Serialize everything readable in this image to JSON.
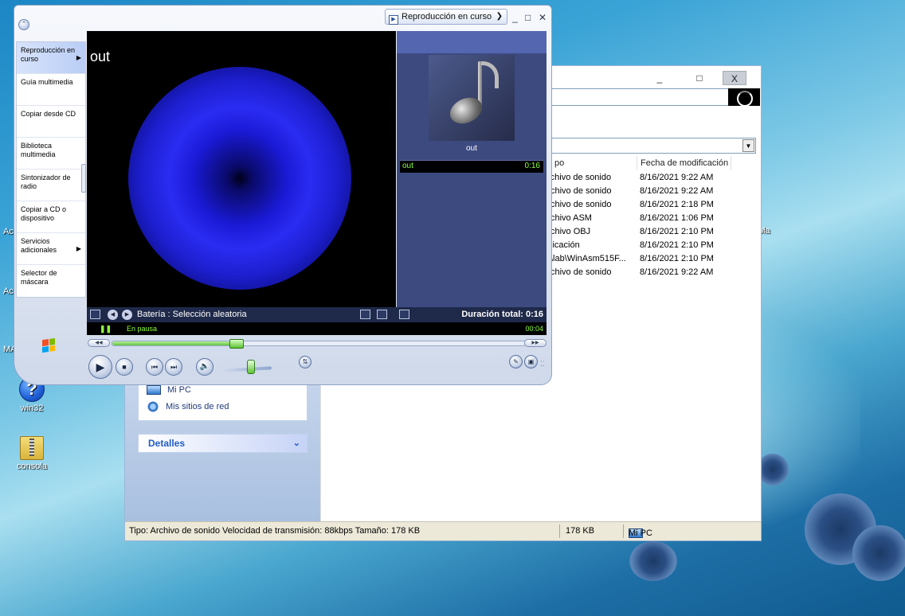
{
  "desktop": {
    "icons": [
      {
        "label": "win32",
        "icon": "help-icon"
      },
      {
        "label": "consola",
        "icon": "zip-folder-icon"
      }
    ],
    "edge_labels": [
      "Ac",
      "Ac",
      "MA",
      "ola"
    ]
  },
  "explorer": {
    "title_buttons": {
      "minimize": "_",
      "maximize": "□",
      "close": "X"
    },
    "columns": {
      "type": "po",
      "modified": "Fecha de modificación"
    },
    "files": [
      {
        "type": "rchivo de sonido",
        "modified": "8/16/2021 9:22 AM"
      },
      {
        "type": "chivo de sonido",
        "modified": "8/16/2021 9:22 AM"
      },
      {
        "type": "chivo de sonido",
        "modified": "8/16/2021 2:18 PM"
      },
      {
        "type": "chivo ASM",
        "modified": "8/16/2021 1:06 PM"
      },
      {
        "type": "chivo OBJ",
        "modified": "8/16/2021 2:10 PM"
      },
      {
        "type": "licación",
        "modified": "8/16/2021 2:10 PM"
      },
      {
        "type": "\\lab\\WinAsm515F...",
        "modified": "8/16/2021 2:10 PM"
      },
      {
        "type": "chivo de sonido",
        "modified": "8/16/2021 9:22 AM"
      }
    ],
    "left_links": [
      {
        "label": "Mi PC",
        "icon": "computer-icon"
      },
      {
        "label": "Mis sitios de red",
        "icon": "network-icon"
      }
    ],
    "details_header": "Detalles",
    "status": {
      "info": "Tipo: Archivo de sonido Velocidad de transmisión: 88kbps Tamaño: 178 KB",
      "size": "178 KB",
      "location": "Mi PC"
    }
  },
  "wmp": {
    "now_playing_tab": "Reproducción en curso",
    "window_buttons": {
      "minimize": "_",
      "maximize": "□",
      "close": "✕"
    },
    "taskpane": [
      {
        "label": "Reproducción en curso",
        "arrow": "▶",
        "selected": true
      },
      {
        "label": "Guía multimedia",
        "arrow": "",
        "selected": false
      },
      {
        "label": "Copiar desde CD",
        "arrow": "",
        "selected": false
      },
      {
        "label": "Biblioteca multimedia",
        "arrow": "",
        "selected": false
      },
      {
        "label": "Sintonizador de radio",
        "arrow": "",
        "selected": false
      },
      {
        "label": "Copiar a CD o dispositivo",
        "arrow": "",
        "selected": false
      },
      {
        "label": "Servicios adicionales",
        "arrow": "▶",
        "selected": false
      },
      {
        "label": "Selector de máscara",
        "arrow": "",
        "selected": false
      }
    ],
    "video_title": "out",
    "album_art_label": "out",
    "playlist": [
      {
        "title": "out",
        "duration": "0:16"
      }
    ],
    "visualization_label": "Batería : Selección aleatoria",
    "total_duration": "Duración total: 0:16",
    "status": "En pausa",
    "elapsed": "00:04",
    "seek_fraction": 0.3,
    "volume_fraction": 0.6,
    "colors": {
      "visualization": "#2a2cf2",
      "status_text": "#8cff3a"
    }
  }
}
